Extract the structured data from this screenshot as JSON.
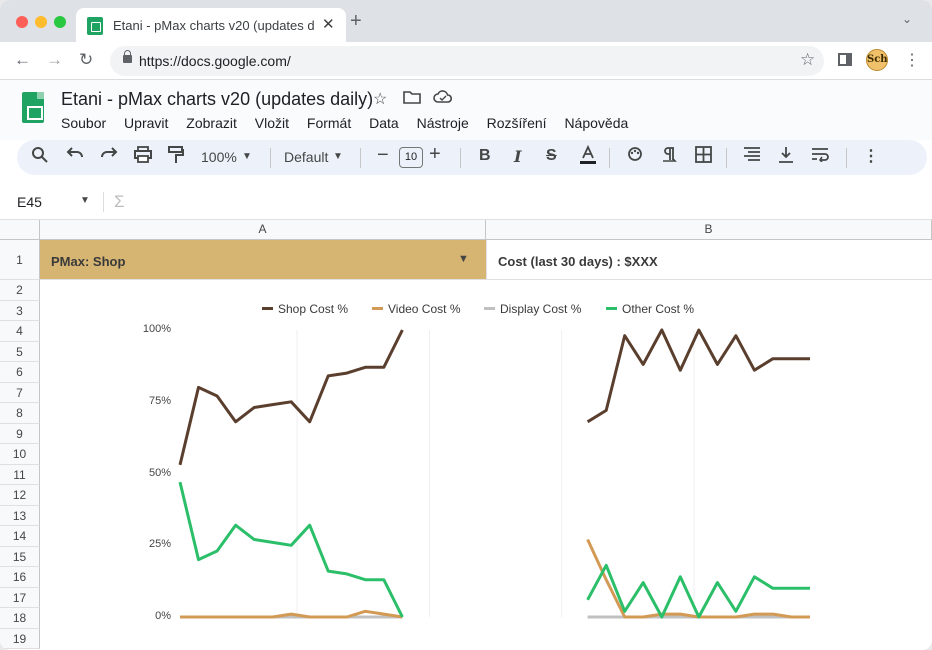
{
  "browser": {
    "tab_title": "Etani - pMax charts v20 (updates d",
    "url": "https://docs.google.com/",
    "avatar_text": "Sch"
  },
  "sheets": {
    "doc_title": "Etani - pMax charts v20 (updates daily)",
    "menu": [
      "Soubor",
      "Upravit",
      "Zobrazit",
      "Vložit",
      "Formát",
      "Data",
      "Nástroje",
      "Rozšíření",
      "Nápověda"
    ],
    "toolbar": {
      "zoom": "100%",
      "font": "Default",
      "font_size": "10"
    },
    "cell_ref": "E45",
    "columns": [
      "A",
      "B"
    ],
    "rows": [
      "1",
      "2",
      "3",
      "4",
      "5",
      "6",
      "7",
      "8",
      "9",
      "10",
      "11",
      "12",
      "13",
      "14",
      "15",
      "16",
      "17",
      "18",
      "19"
    ],
    "cells": {
      "A1": "PMax: Shop",
      "B1": "Cost (last 30 days) : $XXX"
    },
    "colors": {
      "a1_fill": "#d6b472",
      "toolbar_bg": "#edf2fa"
    }
  },
  "chart_data": {
    "type": "line",
    "title": "",
    "xlabel": "",
    "ylabel": "",
    "ylim": [
      0,
      100
    ],
    "yticks": [
      "100%",
      "75%",
      "50%",
      "25%",
      "0%"
    ],
    "legend_position": "top",
    "grid": true,
    "x": [
      1,
      2,
      3,
      4,
      5,
      6,
      7,
      8,
      9,
      10,
      11,
      12,
      13,
      14,
      15,
      16,
      17,
      18,
      19,
      20,
      21,
      22,
      23,
      24,
      25,
      26,
      27,
      28,
      29,
      30,
      31,
      32,
      33,
      34,
      35
    ],
    "series": [
      {
        "name": "Shop Cost %",
        "color": "#5b3f2e",
        "values": [
          53,
          80,
          77,
          68,
          73,
          74,
          75,
          68,
          84,
          85,
          87,
          87,
          100,
          null,
          null,
          null,
          null,
          null,
          null,
          null,
          null,
          null,
          68,
          72,
          98,
          88,
          100,
          86,
          100,
          88,
          98,
          86,
          90,
          90,
          90
        ]
      },
      {
        "name": "Video Cost %",
        "color": "#d39a55",
        "values": [
          0,
          0,
          0,
          0,
          0,
          0,
          1,
          0,
          0,
          0,
          2,
          1,
          0,
          null,
          null,
          null,
          null,
          null,
          null,
          null,
          null,
          null,
          27,
          13,
          0,
          0,
          1,
          1,
          0,
          0,
          0,
          1,
          1,
          0,
          0
        ]
      },
      {
        "name": "Display Cost %",
        "color": "#c0c0c0",
        "values": [
          0,
          0,
          0,
          0,
          0,
          0,
          0,
          0,
          0,
          0,
          0,
          0,
          0,
          null,
          null,
          null,
          null,
          null,
          null,
          null,
          null,
          null,
          0,
          0,
          0,
          0,
          0,
          0,
          0,
          0,
          0,
          0,
          0,
          0,
          0
        ]
      },
      {
        "name": "Other Cost %",
        "color": "#2bbf6a",
        "values": [
          47,
          20,
          23,
          32,
          27,
          26,
          25,
          32,
          16,
          15,
          13,
          13,
          0,
          null,
          null,
          null,
          null,
          null,
          null,
          null,
          null,
          null,
          6,
          18,
          2,
          12,
          0,
          14,
          0,
          12,
          2,
          14,
          10,
          10,
          10
        ]
      }
    ]
  }
}
